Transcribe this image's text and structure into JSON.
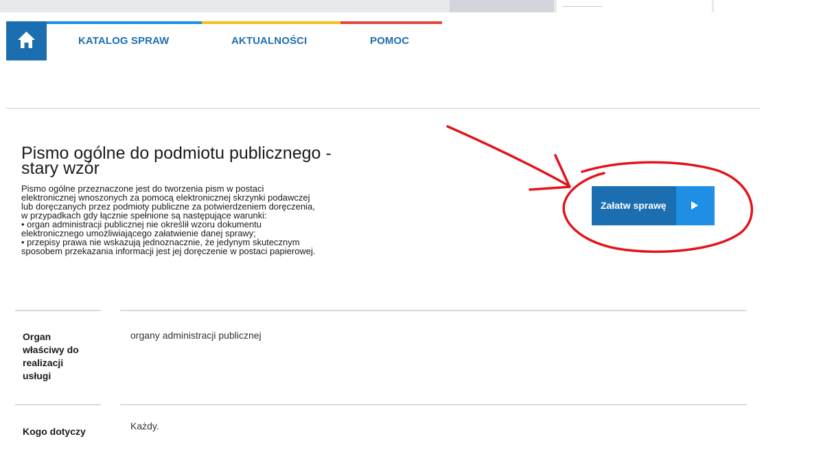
{
  "colors": {
    "primary": "#1b6fb0",
    "primary_light": "#1f8fe6",
    "nav_blue": "#1b8ee8",
    "nav_yellow": "#f1c21b",
    "nav_red": "#e5463a",
    "annotation_red": "#e2131a"
  },
  "nav": {
    "home_icon": "home-icon",
    "items": [
      {
        "label": "KATALOG SPRAW"
      },
      {
        "label": "AKTUALNOŚCI"
      },
      {
        "label": "POMOC"
      }
    ]
  },
  "service": {
    "title_line1": "Pismo ogólne do podmiotu publicznego -",
    "title_line2": "stary wzór",
    "description_lines": [
      "Pismo ogólne przeznaczone jest do tworzenia pism w postaci",
      "elektronicznej wnoszonych za pomocą elektronicznej skrzynki podawczej",
      "lub doręczanych przez podmioty publiczne za potwierdzeniem doręczenia,",
      "w przypadkach gdy łącznie spełnione są następujące warunki:",
      "• organ administracji publicznej nie określił wzoru dokumentu",
      "elektronicznego umożliwiającego załatwienie danej sprawy;",
      "• przepisy prawa nie wskazują jednoznacznie, że jedynym skutecznym",
      "sposobem przekazania informacji jest jej doręczenie w postaci papierowej."
    ],
    "cta_label": "Załatw sprawę",
    "cta_icon": "play-icon"
  },
  "details": [
    {
      "label_lines": [
        "Organ",
        "właściwy do",
        "realizacji",
        "usługi"
      ],
      "value": "organy administracji publicznej"
    },
    {
      "label_lines": [
        "Kogo dotyczy"
      ],
      "value": "Każdy."
    }
  ]
}
